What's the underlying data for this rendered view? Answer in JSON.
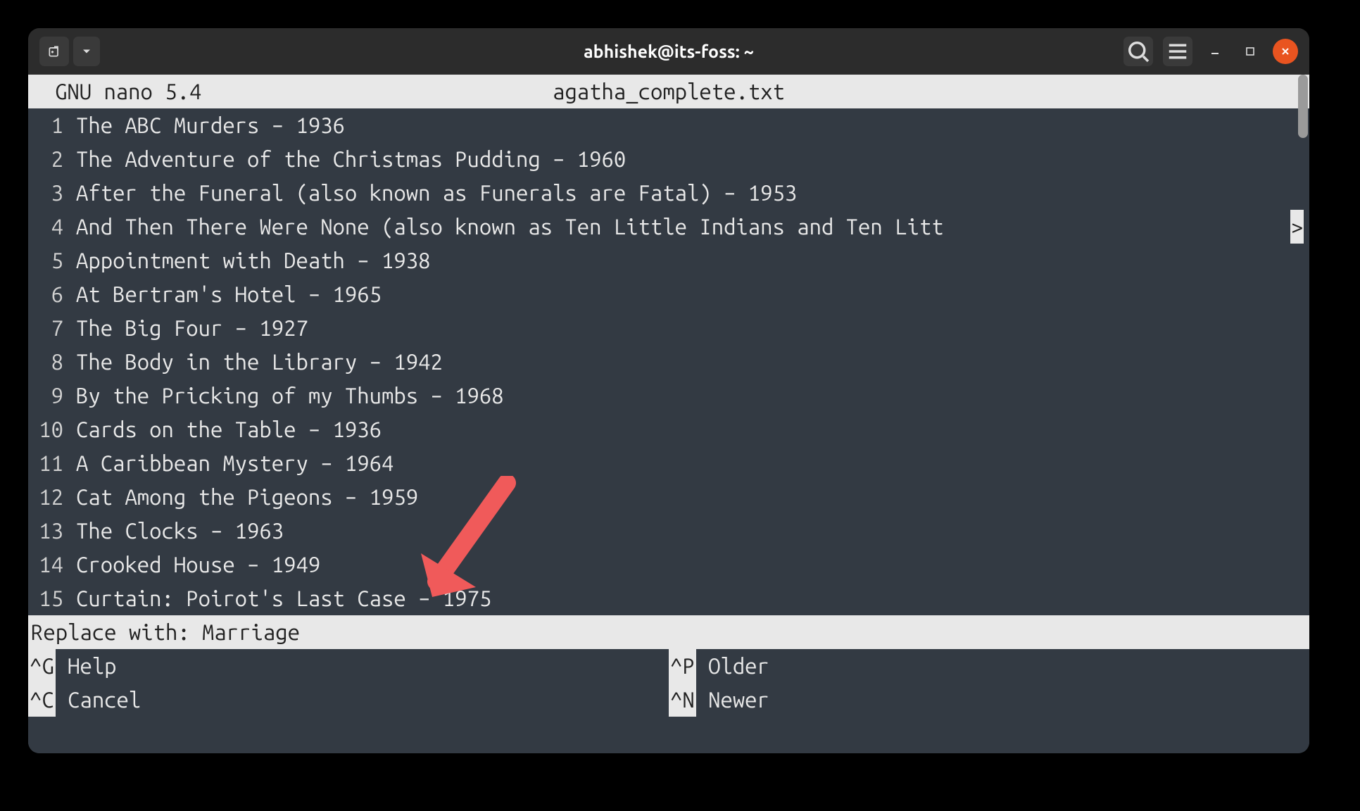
{
  "titlebar": {
    "title": "abhishek@its-foss: ~"
  },
  "nano": {
    "app_label": "GNU nano 5.4",
    "filename": "agatha_complete.txt",
    "continuation_marker": ">"
  },
  "lines": [
    {
      "n": "1",
      "text": "The ABC Murders – 1936"
    },
    {
      "n": "2",
      "text": "The Adventure of the Christmas Pudding – 1960"
    },
    {
      "n": "3",
      "text": "After the Funeral (also known as Funerals are Fatal) – 1953"
    },
    {
      "n": "4",
      "text": "And Then There Were None (also known as Ten Little Indians and Ten Litt",
      "cont": true
    },
    {
      "n": "5",
      "text": "Appointment with Death – 1938"
    },
    {
      "n": "6",
      "text": "At Bertram's Hotel – 1965"
    },
    {
      "n": "7",
      "text": "The Big Four – 1927"
    },
    {
      "n": "8",
      "text": "The Body in the Library – 1942"
    },
    {
      "n": "9",
      "text": "By the Pricking of my Thumbs – 1968"
    },
    {
      "n": "10",
      "text": "Cards on the Table – 1936"
    },
    {
      "n": "11",
      "text": "A Caribbean Mystery – 1964"
    },
    {
      "n": "12",
      "text": "Cat Among the Pigeons – 1959"
    },
    {
      "n": "13",
      "text": "The Clocks – 1963"
    },
    {
      "n": "14",
      "text": "Crooked House – 1949"
    },
    {
      "n": "15",
      "text": "Curtain: Poirot's Last Case – 1975"
    }
  ],
  "prompt": {
    "label": "Replace with: ",
    "value": "Marriage"
  },
  "shortcuts": {
    "g": {
      "key": "^G",
      "label": " Help"
    },
    "c": {
      "key": "^C",
      "label": " Cancel"
    },
    "p": {
      "key": "^P",
      "label": " Older"
    },
    "n": {
      "key": "^N",
      "label": " Newer"
    }
  },
  "annotation": {
    "arrow_color": "#f05a5a"
  }
}
